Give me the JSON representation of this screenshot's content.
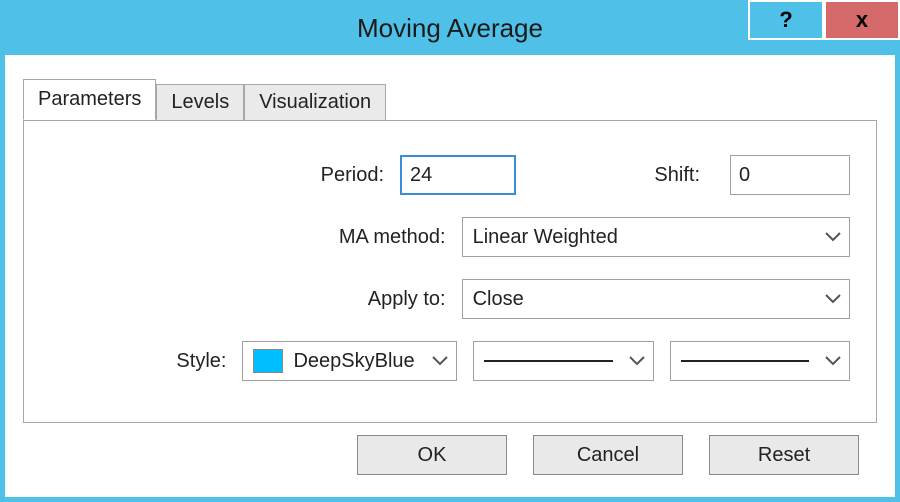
{
  "window": {
    "title": "Moving Average"
  },
  "tabs": {
    "parameters": "Parameters",
    "levels": "Levels",
    "visualization": "Visualization"
  },
  "labels": {
    "period": "Period:",
    "shift": "Shift:",
    "ma_method": "MA method:",
    "apply_to": "Apply to:",
    "style": "Style:"
  },
  "values": {
    "period": "24",
    "shift": "0",
    "ma_method": "Linear Weighted",
    "apply_to": "Close",
    "color_name": "DeepSkyBlue",
    "color_hex": "#00BFFF"
  },
  "buttons": {
    "ok": "OK",
    "cancel": "Cancel",
    "reset": "Reset"
  },
  "titlebar_icons": {
    "help": "?",
    "close": "x"
  }
}
